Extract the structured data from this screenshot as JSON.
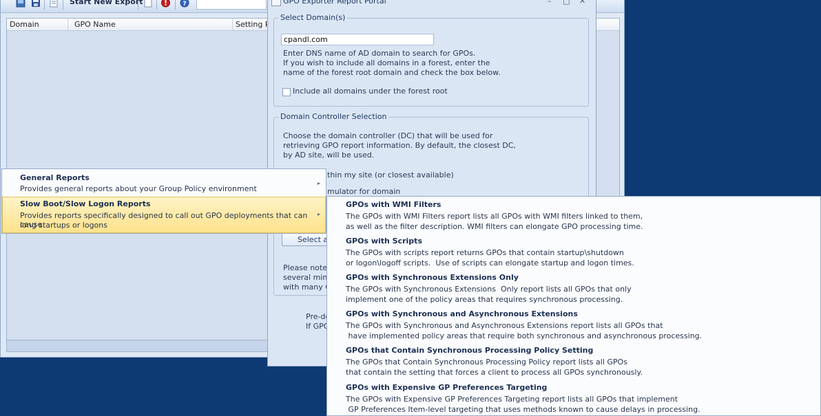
{
  "toolbar": {
    "start_export_label": "Start New Export",
    "icons": [
      "grid-icon",
      "save-icon",
      "document-icon",
      "blank-document-icon",
      "stop-icon",
      "help-icon"
    ]
  },
  "grid": {
    "columns": [
      "Domain",
      "GPO Name",
      "Setting Pa"
    ]
  },
  "dialog": {
    "title": "GPO Exporter Report Portal",
    "domain_group": {
      "label": "Select Domain(s)",
      "input_value": "cpandl.com",
      "help_lines": [
        "Enter DNS name of AD domain to search for GPOs.",
        "If you wish to include all domains in a forest, enter the",
        "name of the forest root domain and check the box below."
      ],
      "checkbox_label": "Include all domains under the forest root"
    },
    "dc_group": {
      "label": "Domain Controller Selection",
      "help_lines": [
        "Choose the domain controller (DC) that will be used for",
        "retrieving GPO report information. By default, the closest DC,",
        "by AD site, will be used."
      ],
      "option_1_partial": "thin my site (or closest available)",
      "option_2_partial": "mulator for domain"
    },
    "select_button_partial": "Select a",
    "note_partial": [
      "Please note t",
      "several minu",
      "with many G"
    ],
    "predef_partial": [
      "Pre-de",
      "If GPO"
    ]
  },
  "context_menu": {
    "items": [
      {
        "title": "General Reports",
        "description": "Provides general reports about your Group Policy environment"
      },
      {
        "title": "Slow Boot/Slow Logon Reports",
        "description_lines": [
          "Provides reports specifically designed to call out GPO deployments that can cause",
          "long startups or logons"
        ]
      }
    ]
  },
  "submenu": {
    "items": [
      {
        "title": "GPOs with WMI Filters",
        "description": "The GPOs with WMI Filters report lists all GPOs with WMI filters linked to them,\nas well as the filter description. WMI filters can elongate GPO processing time."
      },
      {
        "title": "GPOs with Scripts",
        "description": "The GPOs with scripts report returns GPOs that contain startup\\shutdown\nor logon\\logoff scripts.  Use of scripts can elongate startup and logon times."
      },
      {
        "title": "GPOs with Synchronous Extensions Only",
        "description": "The GPOs with Synchronous Extensions  Only report lists all GPOs that only\nimplement one of the policy areas that requires synchronous processing."
      },
      {
        "title": "GPOs with Synchronous and Asynchronous Extensions",
        "description": "The GPOs with Synchronous and Asynchronous Extensions report lists all GPOs that\n have implemented policy areas that require both synchronous and asynchronous processing."
      },
      {
        "title": "GPOs that Contain Synchronous Processing Policy Setting",
        "description": "The GPOs that Contain Synchronous Processing Policy report lists all GPOs\nthat contain the setting that forces a client to process all GPOs synchronously."
      },
      {
        "title": "GPOs with Expensive GP Preferences Targeting",
        "description": "The GPOs with Expensive GP Preferences Targeting report lists all GPOs that implement\n GP Preferences Item-level targeting that uses methods known to cause delays in processing."
      }
    ]
  }
}
